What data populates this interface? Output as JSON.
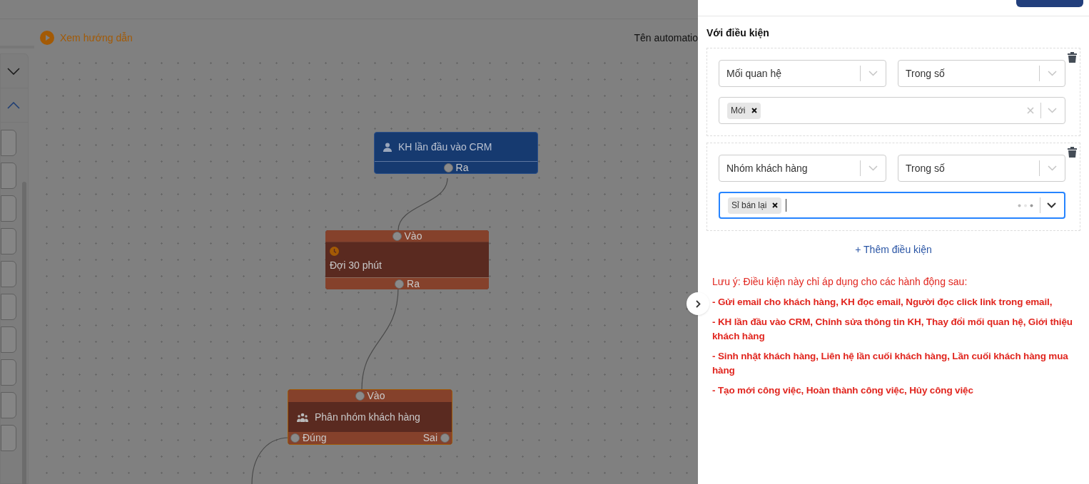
{
  "header": {
    "guide_link": "Xem hướng dẫn",
    "automation_name_label": "Tên automatio"
  },
  "canvas": {
    "nodes": [
      {
        "kind": "trigger",
        "title": "KH lần đầu vào CRM",
        "out_port": "Ra"
      },
      {
        "kind": "wait",
        "in_port": "Vào",
        "title": "Đợi 30 phút",
        "out_port": "Ra"
      },
      {
        "kind": "group",
        "in_port": "Vào",
        "title": "Phân nhóm khách hàng",
        "true_port": "Đúng",
        "false_port": "Sai"
      }
    ]
  },
  "panel": {
    "section_title": "Với điều kiện",
    "conditions": [
      {
        "field": "Mối quan hệ",
        "operator": "Trong số",
        "values": [
          "Mới"
        ],
        "focused": false,
        "loading": false
      },
      {
        "field": "Nhóm khách hàng",
        "operator": "Trong số",
        "values": [
          "Sỉ bán lại"
        ],
        "focused": true,
        "loading": true
      }
    ],
    "add_condition": "+ Thêm điều kiện",
    "note": {
      "heading": "Lưu ý: Điều kiện này chỉ áp dụng cho các hành động sau:",
      "items": [
        "- Gửi email cho khách hàng, KH đọc email, Người đọc click link trong email,",
        "- KH lần đầu vào CRM, Chỉnh sửa thông tin KH, Thay đổi mối quan hệ, Giới thiệu khách hàng",
        "- Sinh nhật khách hàng, Liên hệ lần cuối khách hàng, Lần cuối khách hàng mua hàng",
        "- Tạo mới công việc, Hoàn thành công việc, Hủy công việc"
      ]
    }
  }
}
